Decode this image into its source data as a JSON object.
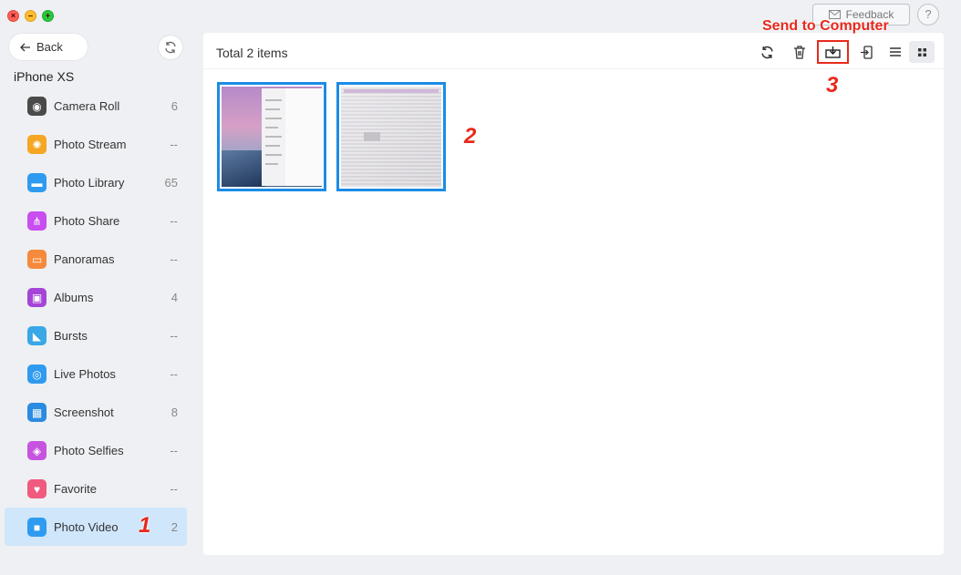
{
  "window": {
    "feedback_label": "Feedback",
    "help_label": "?"
  },
  "sidebar": {
    "back_label": "Back",
    "device_name": "iPhone XS",
    "items": [
      {
        "label": "Camera Roll",
        "count": "6",
        "icon": "camera-icon",
        "color": "#4a4a4a"
      },
      {
        "label": "Photo Stream",
        "count": "--",
        "icon": "sunflower-icon",
        "color": "#f5a623"
      },
      {
        "label": "Photo Library",
        "count": "65",
        "icon": "folder-icon",
        "color": "#2f9bf0"
      },
      {
        "label": "Photo Share",
        "count": "--",
        "icon": "share-icon",
        "color": "#c84ef0"
      },
      {
        "label": "Panoramas",
        "count": "--",
        "icon": "panorama-icon",
        "color": "#f58a3c"
      },
      {
        "label": "Albums",
        "count": "4",
        "icon": "album-icon",
        "color": "#a545d8"
      },
      {
        "label": "Bursts",
        "count": "--",
        "icon": "burst-icon",
        "color": "#3aa7e6"
      },
      {
        "label": "Live Photos",
        "count": "--",
        "icon": "live-photo-icon",
        "color": "#2f9bf0"
      },
      {
        "label": "Screenshot",
        "count": "8",
        "icon": "screenshot-icon",
        "color": "#2a8be0"
      },
      {
        "label": "Photo Selfies",
        "count": "--",
        "icon": "selfie-icon",
        "color": "#c654e0"
      },
      {
        "label": "Favorite",
        "count": "--",
        "icon": "heart-icon",
        "color": "#f05a7e"
      },
      {
        "label": "Photo Video",
        "count": "2",
        "icon": "video-icon",
        "color": "#2f9bf0",
        "active": true
      }
    ]
  },
  "main": {
    "total_label": "Total 2 items"
  },
  "annotations": {
    "step1": "1",
    "step2": "2",
    "step3": "3",
    "send_to_computer": "Send to Computer"
  },
  "colors": {
    "accent": "#1b8ce6",
    "annotation": "#e8291c",
    "active_row": "#cfe6fb"
  }
}
